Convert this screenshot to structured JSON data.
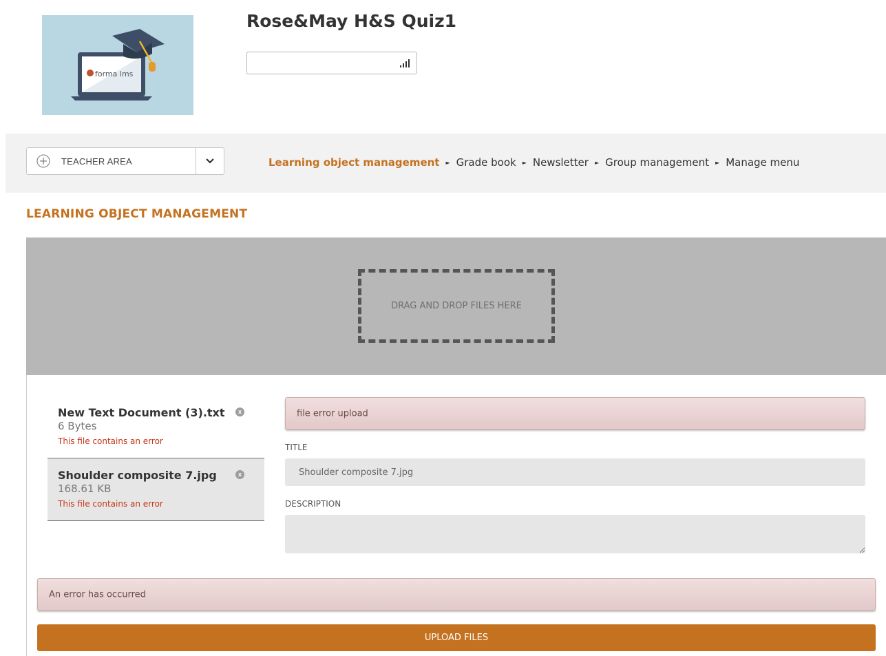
{
  "header": {
    "course_title": "Rose&May H&S Quiz1",
    "logo_text": "forma lms"
  },
  "nav": {
    "teacher_area_label": "TEACHER AREA",
    "breadcrumb": [
      {
        "label": "Learning object management",
        "active": true
      },
      {
        "label": "Grade book",
        "active": false
      },
      {
        "label": "Newsletter",
        "active": false
      },
      {
        "label": "Group management",
        "active": false
      },
      {
        "label": "Manage menu",
        "active": false
      }
    ]
  },
  "page": {
    "heading": "LEARNING OBJECT MANAGEMENT"
  },
  "dropzone": {
    "text": "DRAG AND DROP FILES HERE"
  },
  "files": [
    {
      "name": "New Text Document (3).txt",
      "size": "6 Bytes",
      "error": "This file contains an error",
      "remove": "x"
    },
    {
      "name": "Shoulder composite 7.jpg",
      "size": "168.61 KB",
      "error": "This file contains an error",
      "remove": "x"
    }
  ],
  "form": {
    "upload_error": "file error upload",
    "title_label": "TITLE",
    "title_value": "Shoulder composite 7.jpg",
    "description_label": "DESCRIPTION",
    "description_value": ""
  },
  "footer": {
    "general_error": "An error has occurred",
    "upload_button": "UPLOAD FILES"
  },
  "colors": {
    "accent": "#c47220",
    "error_text": "#c8361a",
    "drop_area_bg": "#b7b7b7"
  }
}
